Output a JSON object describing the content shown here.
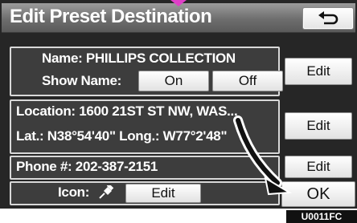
{
  "title": "Edit Preset Destination",
  "back_icon": "return-arrow-icon",
  "name_row": {
    "label": "Name: PHILLIPS COLLECTION",
    "show_name_label": "Show Name:",
    "on_label": "On",
    "off_label": "Off",
    "edit_label": "Edit"
  },
  "location_row": {
    "location_text": "Location: 1600 21ST ST NW, WAS...",
    "coords_text": "Lat.: N38°54'40\"  Long.: W77°2'48\"",
    "edit_label": "Edit"
  },
  "phone_row": {
    "phone_text": "Phone #: 202-387-2151",
    "edit_label": "Edit"
  },
  "icon_row": {
    "icon_label": "Icon:",
    "icon_name": "push-pin-icon",
    "edit_label": "Edit"
  },
  "ok_label": "OK",
  "figure_code": "U0011FC",
  "colors": {
    "screen_bg": "#262626",
    "panel_bg": "#3d3d3d",
    "button_bg": "#f2f2f2",
    "marker": "#e040c8"
  }
}
